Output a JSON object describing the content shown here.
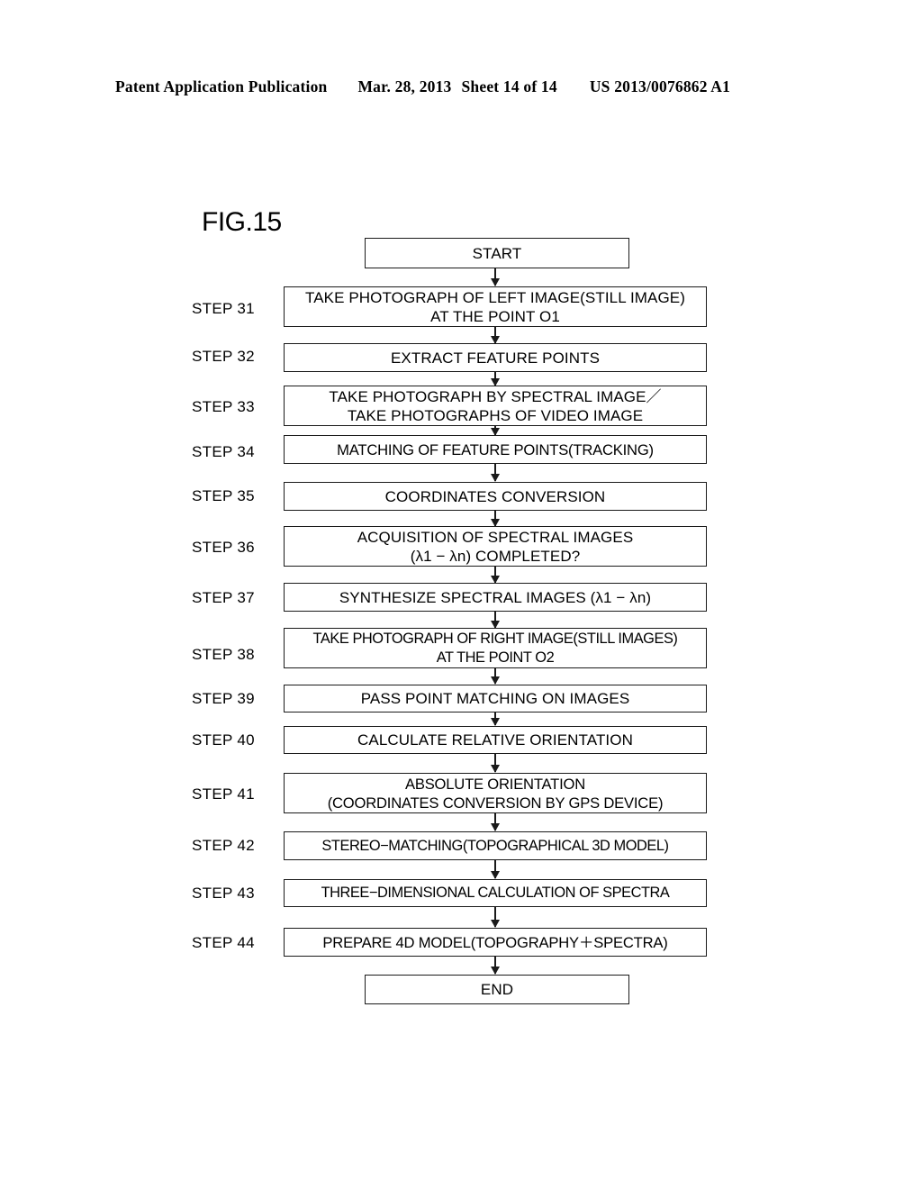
{
  "header": {
    "publication": "Patent Application Publication",
    "date": "Mar. 28, 2013",
    "sheet": "Sheet 14 of 14",
    "number": "US 2013/0076862 A1"
  },
  "figure": {
    "label": "FIG.15"
  },
  "flowchart": {
    "start_label": "START",
    "end_label": "END",
    "steps": [
      {
        "step": "STEP 31",
        "text": "TAKE PHOTOGRAPH OF LEFT IMAGE(STILL IMAGE)\nAT THE POINT O1"
      },
      {
        "step": "STEP 32",
        "text": "EXTRACT FEATURE POINTS"
      },
      {
        "step": "STEP 33",
        "text": "TAKE PHOTOGRAPH BY SPECTRAL IMAGE／\nTAKE PHOTOGRAPHS OF VIDEO IMAGE"
      },
      {
        "step": "STEP 34",
        "text": "MATCHING OF FEATURE POINTS(TRACKING)"
      },
      {
        "step": "STEP 35",
        "text": "COORDINATES CONVERSION"
      },
      {
        "step": "STEP 36",
        "text": "ACQUISITION OF SPECTRAL IMAGES\n(λ1 − λn) COMPLETED?"
      },
      {
        "step": "STEP 37",
        "text": "SYNTHESIZE SPECTRAL IMAGES (λ1 − λn)"
      },
      {
        "step": "STEP 38",
        "text": "TAKE PHOTOGRAPH OF RIGHT IMAGE(STILL IMAGES)\nAT THE POINT O2"
      },
      {
        "step": "STEP 39",
        "text": "PASS POINT MATCHING ON IMAGES"
      },
      {
        "step": "STEP 40",
        "text": "CALCULATE RELATIVE ORIENTATION"
      },
      {
        "step": "STEP 41",
        "text": "ABSOLUTE ORIENTATION\n(COORDINATES CONVERSION BY GPS DEVICE)"
      },
      {
        "step": "STEP 42",
        "text": "STEREO−MATCHING(TOPOGRAPHICAL 3D MODEL)"
      },
      {
        "step": "STEP 43",
        "text": "THREE−DIMENSIONAL CALCULATION OF SPECTRA"
      },
      {
        "step": "STEP 44",
        "text": "PREPARE 4D MODEL(TOPOGRAPHY＋SPECTRA)"
      }
    ]
  }
}
